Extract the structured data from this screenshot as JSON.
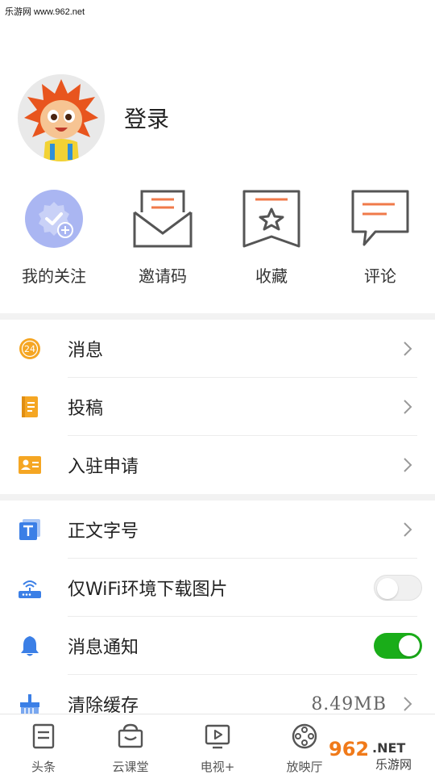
{
  "watermark_top": "乐游网 www.962.net",
  "profile": {
    "login_label": "登录"
  },
  "quick_actions": [
    {
      "label": "我的关注",
      "icon": "follow-badge-icon"
    },
    {
      "label": "邀请码",
      "icon": "envelope-icon"
    },
    {
      "label": "收藏",
      "icon": "star-bookmark-icon"
    },
    {
      "label": "评论",
      "icon": "comment-icon"
    }
  ],
  "menu1": [
    {
      "label": "消息",
      "icon": "message-24-icon",
      "badge": "24"
    },
    {
      "label": "投稿",
      "icon": "notebook-icon"
    },
    {
      "label": "入驻申请",
      "icon": "id-card-icon"
    }
  ],
  "menu2": {
    "font_size": {
      "label": "正文字号",
      "icon": "text-size-icon"
    },
    "wifi_images": {
      "label": "仅WiFi环境下载图片",
      "icon": "router-icon",
      "enabled": false
    },
    "notifications": {
      "label": "消息通知",
      "icon": "bell-icon",
      "enabled": true
    },
    "clear_cache": {
      "label": "清除缓存",
      "icon": "broom-icon",
      "value": "8.49MB"
    }
  },
  "bottom_nav": [
    {
      "label": "头条",
      "icon": "headline-icon"
    },
    {
      "label": "云课堂",
      "icon": "cloud-class-icon"
    },
    {
      "label": "电视+",
      "icon": "tv-icon"
    },
    {
      "label": "放映厅",
      "icon": "film-reel-icon"
    }
  ],
  "watermark_logo": {
    "top": "962",
    "suffix": ".NET",
    "bottom": "乐游网"
  },
  "colors": {
    "accent_orange": "#f07a4a",
    "icon_gray": "#555555",
    "toggle_on": "#1aad19",
    "blue": "#3b7fe6",
    "gold": "#f5a623"
  }
}
